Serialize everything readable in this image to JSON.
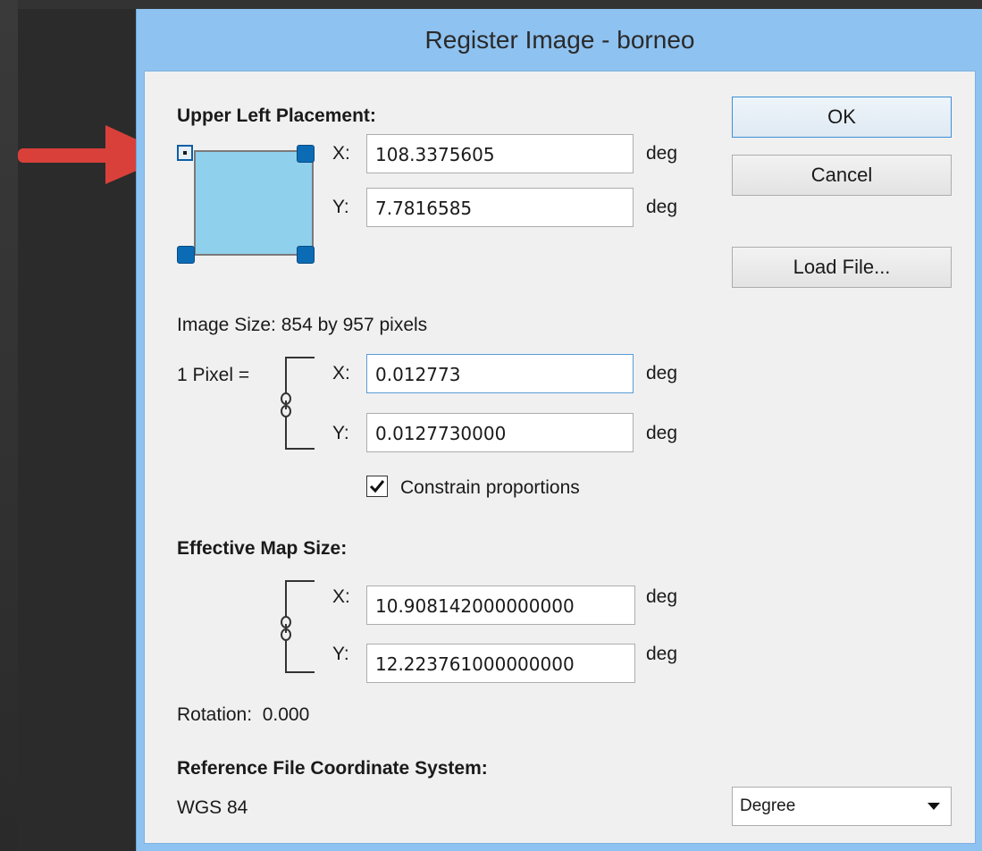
{
  "window": {
    "title": "Register Image - borneo"
  },
  "placement": {
    "heading": "Upper Left Placement:",
    "x_label": "X:",
    "x_value": "108.3375605",
    "x_unit": "deg",
    "y_label": "Y:",
    "y_value": "7.7816585",
    "y_unit": "deg"
  },
  "buttons": {
    "ok": "OK",
    "cancel": "Cancel",
    "load_file": "Load File..."
  },
  "image_size": {
    "text": "Image Size: 854 by 957 pixels",
    "pixel_label": "1 Pixel =",
    "x_label": "X:",
    "x_value": "0.012773",
    "x_unit": "deg",
    "y_label": "Y:",
    "y_value": "0.0127730000",
    "y_unit": "deg",
    "constrain_label": "Constrain proportions",
    "constrain_checked": true
  },
  "effective_map_size": {
    "heading": "Effective Map Size:",
    "x_label": "X:",
    "x_value": "10.908142000000000",
    "x_unit": "deg",
    "y_label": "Y:",
    "y_value": "12.223761000000000",
    "y_unit": "deg"
  },
  "rotation": {
    "text": "Rotation:  0.000"
  },
  "reference": {
    "heading": "Reference File Coordinate System:",
    "system": "WGS 84",
    "unit_selected": "Degree"
  },
  "colors": {
    "title_bar": "#8ec2f0",
    "arrow": "#d9403a",
    "handle": "#0b6cb5",
    "placement_fill": "#8fd0ec"
  },
  "icons": [
    "arrow-pointer-icon",
    "link-chain-icon",
    "checkmark-icon",
    "dropdown-arrow-icon"
  ]
}
